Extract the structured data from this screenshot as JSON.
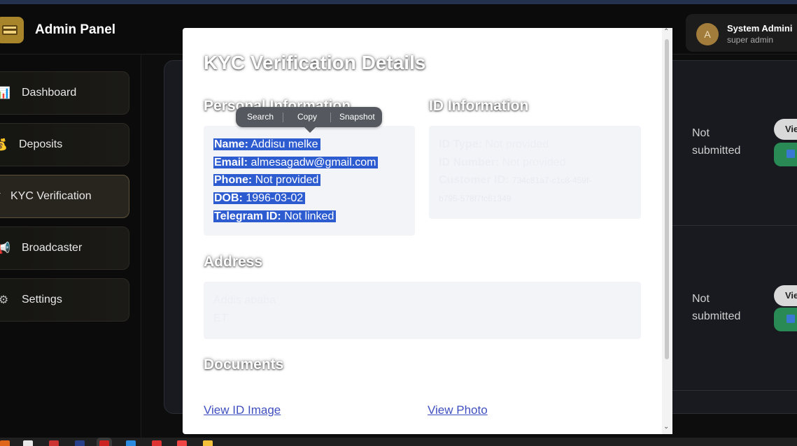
{
  "header": {
    "brand": "Admin Panel",
    "user_name": "System Admini",
    "user_role": "super admin",
    "avatar_letter": "A"
  },
  "sidebar": {
    "items": [
      {
        "label": "Dashboard",
        "icon": "bar-chart-icon"
      },
      {
        "label": "Deposits",
        "icon": "money-bag-icon"
      },
      {
        "label": "KYC Verification",
        "icon": "check-icon",
        "active": true
      },
      {
        "label": "Broadcaster",
        "icon": "megaphone-icon"
      },
      {
        "label": "Settings",
        "icon": "gear-icon"
      }
    ]
  },
  "table": {
    "rows": [
      {
        "status": "Not submitted",
        "view_label": "Vie"
      },
      {
        "status": "Not submitted",
        "view_label": "Vie"
      }
    ]
  },
  "modal": {
    "title": "KYC Verification Details",
    "personal": {
      "heading": "Personal Information",
      "name_label": "Name:",
      "name_value": "Addisu melke",
      "email_label": "Email:",
      "email_value": "almesagadw@gmail.com",
      "phone_label": "Phone:",
      "phone_value": "Not provided",
      "dob_label": "DOB:",
      "dob_value": "1996-03-02",
      "telegram_label": "Telegram ID:",
      "telegram_value": "Not linked"
    },
    "id_info": {
      "heading": "ID Information",
      "type_label": "ID Type:",
      "type_value": "Not provided",
      "number_label": "ID Number:",
      "number_value": "Not provided",
      "customer_label": "Customer ID:",
      "customer_value_line1": "734c81a7-c1c8-459f-",
      "customer_value_line2": "b795-578f7fc61349"
    },
    "address": {
      "heading": "Address",
      "line1": "Addis ababa",
      "line2": "ET"
    },
    "documents": {
      "heading": "Documents",
      "id_image_link": "View ID Image",
      "photo_link": "View Photo"
    }
  },
  "context_menu": {
    "search": "Search",
    "copy": "Copy",
    "snapshot": "Snapshot"
  }
}
